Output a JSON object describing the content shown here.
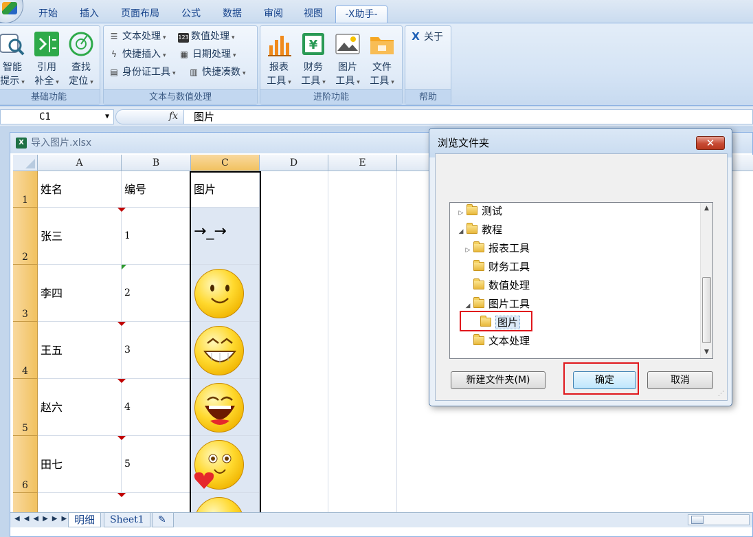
{
  "ribbon": {
    "tabs": [
      "开始",
      "插入",
      "页面布局",
      "公式",
      "数据",
      "审阅",
      "视图",
      "-X助手-"
    ],
    "active_tab": "-X助手-",
    "groups": {
      "basic": {
        "label": "基础功能",
        "buttons": [
          {
            "line1": "智能",
            "line2": "提示"
          },
          {
            "line1": "引用",
            "line2": "补全"
          },
          {
            "line1": "查找",
            "line2": "定位"
          }
        ]
      },
      "text": {
        "label": "文本与数值处理",
        "items": [
          "文本处理",
          "数值处理",
          "快捷插入",
          "日期处理",
          "身份证工具",
          "快捷凑数"
        ]
      },
      "advanced": {
        "label": "进阶功能",
        "buttons": [
          {
            "line1": "报表",
            "line2": "工具"
          },
          {
            "line1": "财务",
            "line2": "工具"
          },
          {
            "line1": "图片",
            "line2": "工具"
          },
          {
            "line1": "文件",
            "line2": "工具"
          }
        ]
      },
      "help": {
        "label": "帮助",
        "about": "关于"
      }
    }
  },
  "formula_bar": {
    "cell_ref": "C1",
    "fx": "fx",
    "value": "图片"
  },
  "workbook": {
    "title": "导入图片.xlsx",
    "columns": [
      "A",
      "B",
      "C",
      "D",
      "E"
    ],
    "selected_column": "C",
    "rows": [
      {
        "num": "1",
        "a": "姓名",
        "b": "编号",
        "c": "图片"
      },
      {
        "num": "2",
        "a": "张三",
        "b": "1",
        "c": "→_→"
      },
      {
        "num": "3",
        "a": "李四",
        "b": "2"
      },
      {
        "num": "4",
        "a": "王五",
        "b": "3"
      },
      {
        "num": "5",
        "a": "赵六",
        "b": "4"
      },
      {
        "num": "6",
        "a": "田七",
        "b": "5"
      }
    ],
    "sheet_tabs": [
      "明细",
      "Sheet1"
    ],
    "active_sheet": "明细"
  },
  "dialog": {
    "title": "浏览文件夹",
    "close": "✕",
    "tree": [
      {
        "label": "测试",
        "level": 0,
        "state": "collapsed"
      },
      {
        "label": "教程",
        "level": 0,
        "state": "expanded"
      },
      {
        "label": "报表工具",
        "level": 1,
        "state": "collapsed"
      },
      {
        "label": "财务工具",
        "level": 1,
        "state": "leaf"
      },
      {
        "label": "数值处理",
        "level": 1,
        "state": "leaf"
      },
      {
        "label": "图片工具",
        "level": 1,
        "state": "expanded"
      },
      {
        "label": "图片",
        "level": 2,
        "state": "selected"
      },
      {
        "label": "文本处理",
        "level": 1,
        "state": "leaf"
      }
    ],
    "buttons": {
      "new_folder": "新建文件夹(M)",
      "ok": "确定",
      "cancel": "取消"
    }
  },
  "colors": {
    "ribbon_bg": "#d5e4f5",
    "row_header_selected": "#f1c15f",
    "highlight_red": "#e0161b",
    "excel_green": "#1e7145"
  }
}
